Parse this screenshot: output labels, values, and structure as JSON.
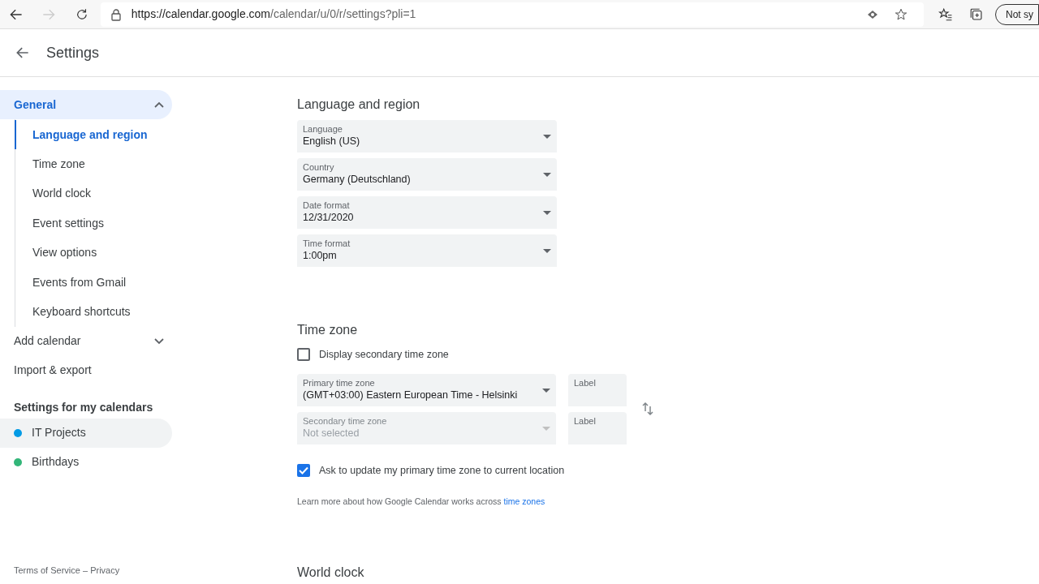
{
  "browser": {
    "url_host": "https://calendar.google.com",
    "url_path": "/calendar/u/0/r/settings?pli=1",
    "sync_button": "Not sy"
  },
  "header": {
    "title": "Settings"
  },
  "sidebar": {
    "items": [
      {
        "kind": "group",
        "label": "General",
        "expanded": true,
        "selected": true,
        "children": [
          {
            "label": "Language and region",
            "selected": true
          },
          {
            "label": "Time zone",
            "selected": false
          },
          {
            "label": "World clock",
            "selected": false
          },
          {
            "label": "Event settings",
            "selected": false
          },
          {
            "label": "View options",
            "selected": false
          },
          {
            "label": "Events from Gmail",
            "selected": false
          },
          {
            "label": "Keyboard shortcuts",
            "selected": false
          }
        ]
      },
      {
        "kind": "group",
        "label": "Add calendar",
        "expanded": false,
        "selected": false
      },
      {
        "kind": "link",
        "label": "Import & export"
      }
    ],
    "calendars_heading": "Settings for my calendars",
    "calendars": [
      {
        "label": "IT Projects",
        "color": "#039be5",
        "highlighted": true
      },
      {
        "label": "Birthdays",
        "color": "#33b679",
        "highlighted": false
      }
    ],
    "footer": "Terms of Service – Privacy"
  },
  "language_region": {
    "title": "Language and region",
    "fields": [
      {
        "label": "Language",
        "value": "English (US)"
      },
      {
        "label": "Country",
        "value": "Germany (Deutschland)"
      },
      {
        "label": "Date format",
        "value": "12/31/2020"
      },
      {
        "label": "Time format",
        "value": "1:00pm"
      }
    ]
  },
  "time_zone": {
    "title": "Time zone",
    "secondary_checkbox": {
      "label": "Display secondary time zone",
      "checked": false
    },
    "zones": [
      {
        "label": "Primary time zone",
        "value": "(GMT+03:00) Eastern European Time - Helsinki",
        "disabled": false,
        "label_placeholder": "Label"
      },
      {
        "label": "Secondary time zone",
        "value": "Not selected",
        "disabled": true,
        "label_placeholder": "Label"
      }
    ],
    "update_checkbox": {
      "label": "Ask to update my primary time zone to current location",
      "checked": true
    },
    "help_text": "Learn more about how Google Calendar works across ",
    "help_link": "time zones"
  },
  "world_clock": {
    "title": "World clock"
  }
}
